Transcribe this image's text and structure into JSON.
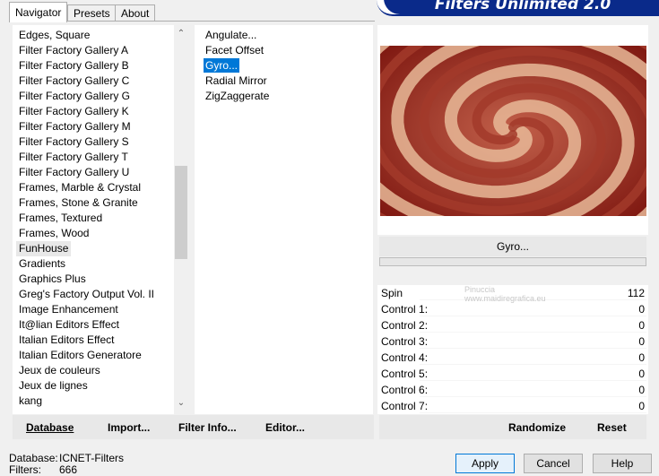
{
  "banner": {
    "title": "Filters Unlimited 2.0"
  },
  "tabs": [
    {
      "label": "Navigator"
    },
    {
      "label": "Presets"
    },
    {
      "label": "About"
    }
  ],
  "categories": [
    "Edges, Square",
    "Filter Factory Gallery A",
    "Filter Factory Gallery B",
    "Filter Factory Gallery C",
    "Filter Factory Gallery G",
    "Filter Factory Gallery K",
    "Filter Factory Gallery M",
    "Filter Factory Gallery S",
    "Filter Factory Gallery T",
    "Filter Factory Gallery U",
    "Frames, Marble & Crystal",
    "Frames, Stone & Granite",
    "Frames, Textured",
    "Frames, Wood",
    "FunHouse",
    "Gradients",
    "Graphics Plus",
    "Greg's Factory Output Vol. II",
    "Image Enhancement",
    "It@lian Editors Effect",
    "Italian Editors Effect",
    "Italian Editors Generatore",
    "Jeux de couleurs",
    "Jeux de lignes",
    "kang"
  ],
  "selected_category": "FunHouse",
  "filters": [
    "Angulate...",
    "Facet Offset",
    "Gyro...",
    "Radial Mirror",
    "ZigZaggerate"
  ],
  "selected_filter": "Gyro...",
  "bottom_buttons": {
    "database": "Database",
    "import": "Import...",
    "filter_info": "Filter Info...",
    "editor": "Editor..."
  },
  "filter_name_button": "Gyro...",
  "controls": [
    {
      "label": "Spin",
      "value": "112"
    },
    {
      "label": "Control 1:",
      "value": "0"
    },
    {
      "label": "Control 2:",
      "value": "0"
    },
    {
      "label": "Control 3:",
      "value": "0"
    },
    {
      "label": "Control 4:",
      "value": "0"
    },
    {
      "label": "Control 5:",
      "value": "0"
    },
    {
      "label": "Control 6:",
      "value": "0"
    },
    {
      "label": "Control 7:",
      "value": "0"
    }
  ],
  "actions": {
    "randomize": "Randomize",
    "reset": "Reset"
  },
  "dialog": {
    "apply": "Apply",
    "cancel": "Cancel",
    "help": "Help"
  },
  "status": {
    "database_label": "Database:",
    "database_value": "ICNET-Filters",
    "filters_label": "Filters:",
    "filters_value": "666"
  },
  "watermark": {
    "line1": "Pinuccia",
    "line2": "www.maidiregrafica.eu"
  },
  "colors": {
    "selection": "#0078d7",
    "banner": "#0a2a8a",
    "swirl_dark": "#8b1a12",
    "swirl_light": "#e8b898"
  }
}
